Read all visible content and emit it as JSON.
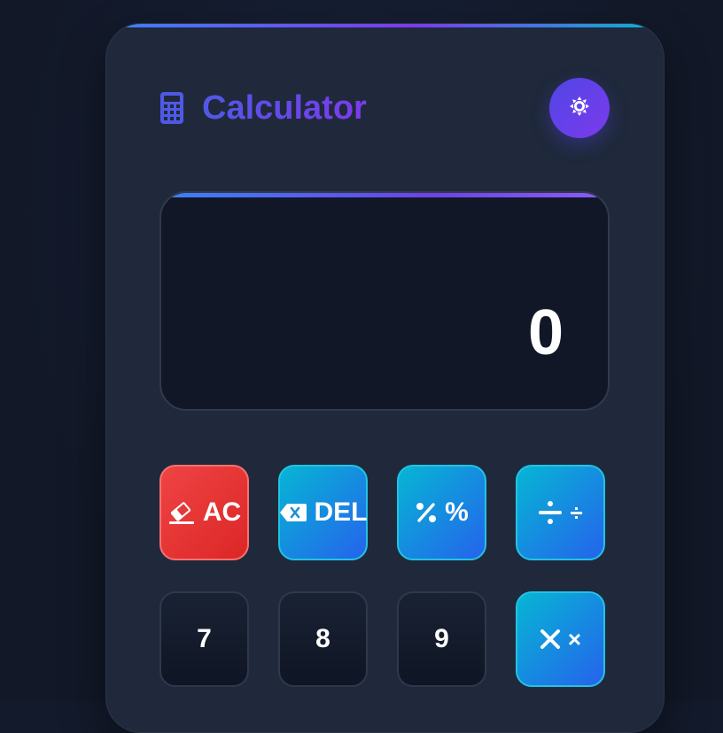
{
  "app": {
    "title": "Calculator",
    "icons": {
      "title": "calculator-icon",
      "theme_toggle": "sun-icon"
    }
  },
  "display": {
    "value": "0"
  },
  "keypad": {
    "row1": [
      {
        "label": "AC",
        "icon": "eraser-icon",
        "kind": "clear"
      },
      {
        "label": "DEL",
        "icon": "backspace-icon",
        "kind": "delete"
      },
      {
        "label": "%",
        "icon": "percent-icon",
        "kind": "operator"
      },
      {
        "label": "÷",
        "icon": "divide-icon",
        "kind": "operator"
      }
    ],
    "row2": [
      {
        "label": "7",
        "kind": "number"
      },
      {
        "label": "8",
        "kind": "number"
      },
      {
        "label": "9",
        "kind": "number"
      },
      {
        "label": "×",
        "icon": "multiply-icon",
        "kind": "operator"
      }
    ]
  },
  "colors": {
    "accent": "#5b5ff0",
    "clear_key": "#ef4444",
    "operator_key": "#06b6d4",
    "number_key": "#141c2e"
  }
}
